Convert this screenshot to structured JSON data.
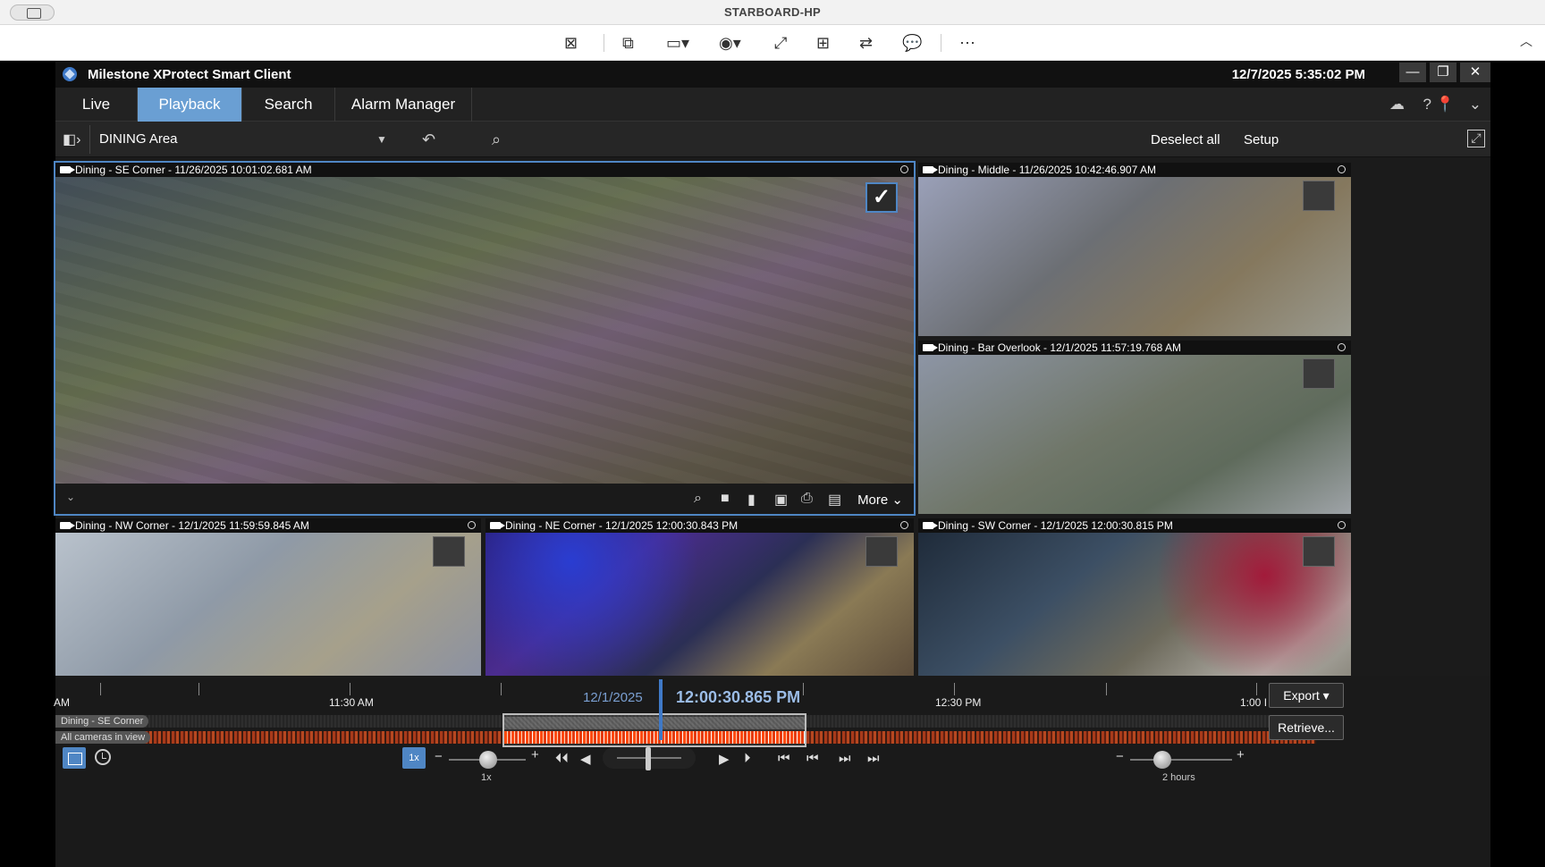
{
  "remote": {
    "title": "STARBOARD-HP",
    "tools": [
      "close-session-icon",
      "sync-screens-icon",
      "display-icon",
      "view-icon",
      "fullscreen-icon",
      "multimonitor-icon",
      "transfer-icon",
      "chat-icon",
      "more-icon"
    ]
  },
  "app": {
    "name": "Milestone XProtect Smart Client",
    "clock": "12/7/2025 5:35:02 PM",
    "tabs": [
      {
        "label": "Live",
        "active": false
      },
      {
        "label": "Playback",
        "active": true
      },
      {
        "label": "Search",
        "active": false
      },
      {
        "label": "Alarm Manager",
        "active": false
      }
    ]
  },
  "viewbar": {
    "view_name": "DINING Area",
    "deselect_label": "Deselect all",
    "setup_label": "Setup"
  },
  "cameras": [
    {
      "key": "se",
      "title": "Dining - SE Corner - 11/26/2025 10:01:02.681 AM",
      "checked": true
    },
    {
      "key": "middle",
      "title": "Dining - Middle - 11/26/2025 10:42:46.907 AM",
      "checked": false
    },
    {
      "key": "bar",
      "title": "Dining - Bar Overlook - 12/1/2025 11:57:19.768 AM",
      "checked": false
    },
    {
      "key": "nw",
      "title": "Dining - NW Corner - 12/1/2025 11:59:59.845 AM",
      "checked": false
    },
    {
      "key": "ne",
      "title": "Dining - NE Corner - 12/1/2025 12:00:30.843 PM",
      "checked": false
    },
    {
      "key": "sw",
      "title": "Dining - SW Corner - 12/1/2025 12:00:30.815 PM",
      "checked": false
    }
  ],
  "camera_toolbar": {
    "more_label": "More"
  },
  "timeline": {
    "labels": [
      "AM",
      "11:30 AM",
      "12:30 PM",
      "1:00 I"
    ],
    "date": "12/1/2025",
    "current_time": "12:00:30.865 PM",
    "track1_label": "Dining - SE Corner",
    "track2_label": "All cameras in view",
    "help": "?",
    "export_label": "Export",
    "retrieve_label": "Retrieve...",
    "speed_value": "1x",
    "speed_label": "1x",
    "span_label": "2 hours"
  },
  "colors": {
    "accent": "#4f86c4",
    "active_tab": "#6a9fd3",
    "timeline_recording": "#b74720"
  }
}
